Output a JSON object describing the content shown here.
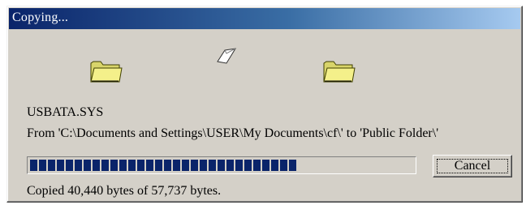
{
  "window": {
    "title": "Copying..."
  },
  "animation": {
    "source_icon": "folder-icon",
    "target_icon": "folder-icon",
    "moving_icon": "flying-document-icon"
  },
  "file": {
    "name": "USBATA.SYS",
    "from_line": "From 'C:\\Documents and Settings\\USER\\My Documents\\cf\\' to 'Public Folder\\'"
  },
  "progress": {
    "fraction": 0.7,
    "bar_color": "#0a246a"
  },
  "buttons": {
    "cancel_label": "Cancel"
  },
  "status": {
    "text": "Copied 40,440 bytes of 57,737 bytes."
  },
  "colors": {
    "window_bg": "#d4d0c8",
    "titlebar_start": "#0a246a",
    "titlebar_end": "#a6caf0",
    "folder_fill": "#f4f08a"
  }
}
